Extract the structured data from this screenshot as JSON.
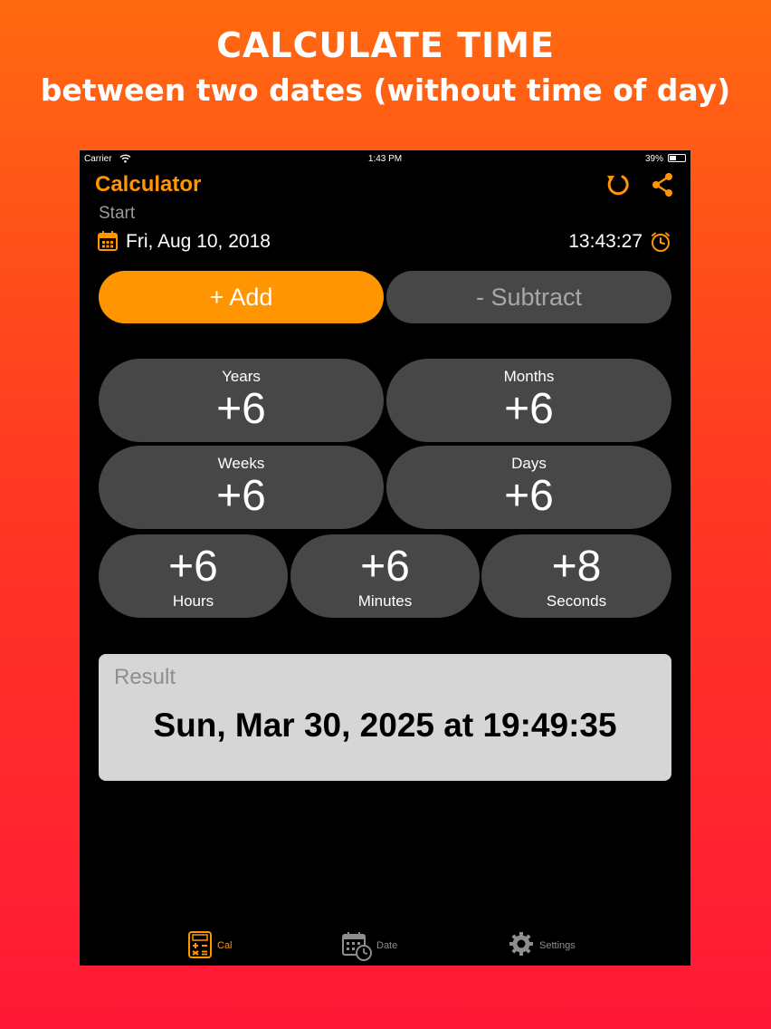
{
  "promo": {
    "line1": "CALCULATE TIME",
    "line2": "between two dates (without time of day)"
  },
  "status_bar": {
    "carrier": "Carrier",
    "time": "1:43 PM",
    "battery": "39%"
  },
  "nav": {
    "title": "Calculator",
    "refresh_icon": "refresh-icon",
    "share_icon": "share-icon"
  },
  "start": {
    "label": "Start",
    "date": "Fri, Aug 10, 2018",
    "time": "13:43:27"
  },
  "mode": {
    "add": "+ Add",
    "subtract": "- Subtract",
    "selected": "add"
  },
  "units": {
    "years": {
      "label": "Years",
      "value": "+6"
    },
    "months": {
      "label": "Months",
      "value": "+6"
    },
    "weeks": {
      "label": "Weeks",
      "value": "+6"
    },
    "days": {
      "label": "Days",
      "value": "+6"
    },
    "hours": {
      "label": "Hours",
      "value": "+6"
    },
    "minutes": {
      "label": "Minutes",
      "value": "+6"
    },
    "seconds": {
      "label": "Seconds",
      "value": "+8"
    }
  },
  "result": {
    "label": "Result",
    "value": "Sun, Mar 30, 2025 at 19:49:35"
  },
  "tabs": [
    {
      "label": "Cal",
      "icon": "calculator-icon",
      "active": true
    },
    {
      "label": "Date",
      "icon": "calendar-clock-icon",
      "active": false
    },
    {
      "label": "Settings",
      "icon": "gear-icon",
      "active": false
    }
  ],
  "colors": {
    "accent": "#ff9500",
    "pill": "#474747",
    "result_bg": "#d6d6d6"
  }
}
